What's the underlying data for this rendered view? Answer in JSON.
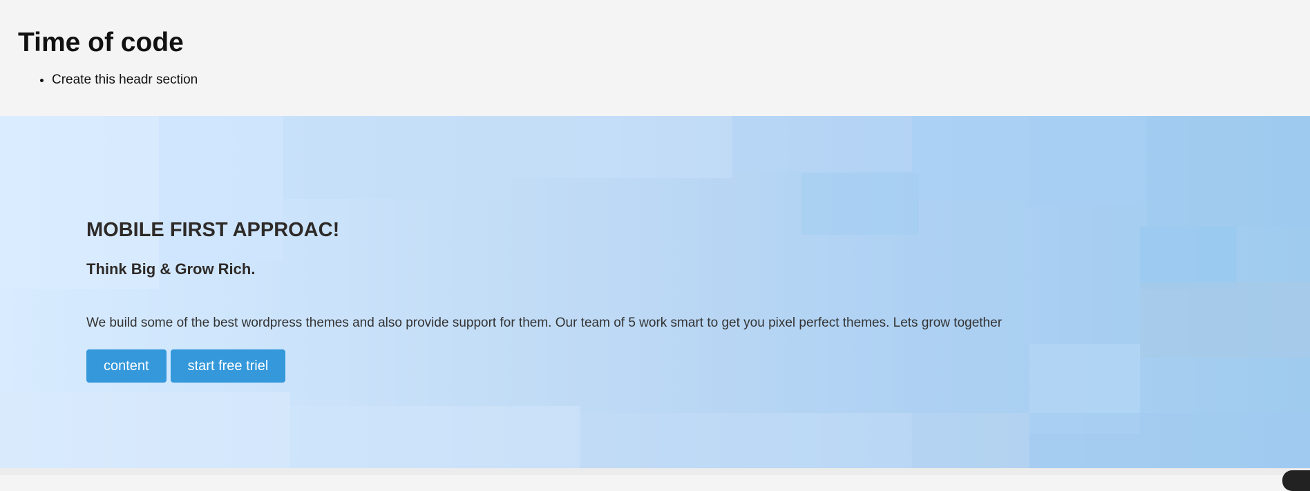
{
  "header": {
    "title": "Time of code",
    "tasks": [
      "Create this headr section"
    ]
  },
  "hero": {
    "title": "MOBILE FIRST APPROAC!",
    "subtitle": "Think Big & Grow Rich.",
    "description": "We build some of the best wordpress themes and also provide support for them. Our team of 5 work smart to get you pixel perfect themes. Lets grow together",
    "buttons": {
      "content_label": "content",
      "trial_label": "start free triel"
    }
  },
  "colors": {
    "button_bg": "#3498db",
    "hero_text": "#2e2a28",
    "page_bg": "#f4f4f4"
  }
}
